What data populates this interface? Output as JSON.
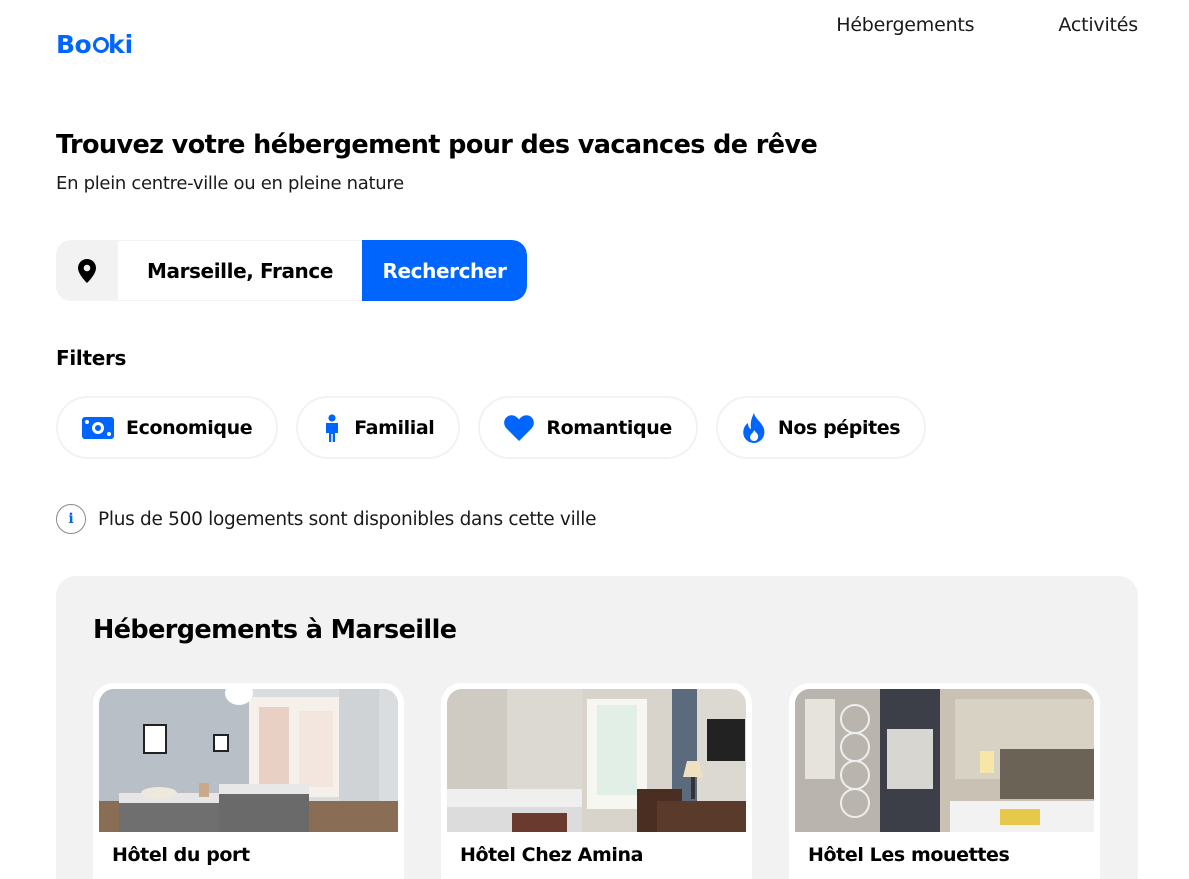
{
  "logo": {
    "text": "Booki"
  },
  "nav": {
    "items": [
      {
        "label": "Hébergements"
      },
      {
        "label": "Activités"
      }
    ]
  },
  "hero": {
    "title": "Trouvez votre hébergement pour des vacances de rêve",
    "subtitle": "En plein centre-ville ou en pleine nature"
  },
  "search": {
    "icon": "map-pin-icon",
    "value": "Marseille, France",
    "button_label": "Rechercher"
  },
  "filters": {
    "title": "Filters",
    "items": [
      {
        "label": "Economique",
        "icon": "money-bill-icon"
      },
      {
        "label": "Familial",
        "icon": "person-icon"
      },
      {
        "label": "Romantique",
        "icon": "heart-icon"
      },
      {
        "label": "Nos pépites",
        "icon": "fire-icon"
      }
    ]
  },
  "info": {
    "icon": "info-icon",
    "text": "Plus de 500 logements sont disponibles dans cette ville"
  },
  "listings": {
    "title": "Hébergements à Marseille",
    "cards": [
      {
        "name": "Hôtel du port"
      },
      {
        "name": "Hôtel Chez Amina"
      },
      {
        "name": "Hôtel Les mouettes"
      }
    ]
  },
  "colors": {
    "accent": "#0065fc",
    "section_bg": "#f2f2f2"
  }
}
